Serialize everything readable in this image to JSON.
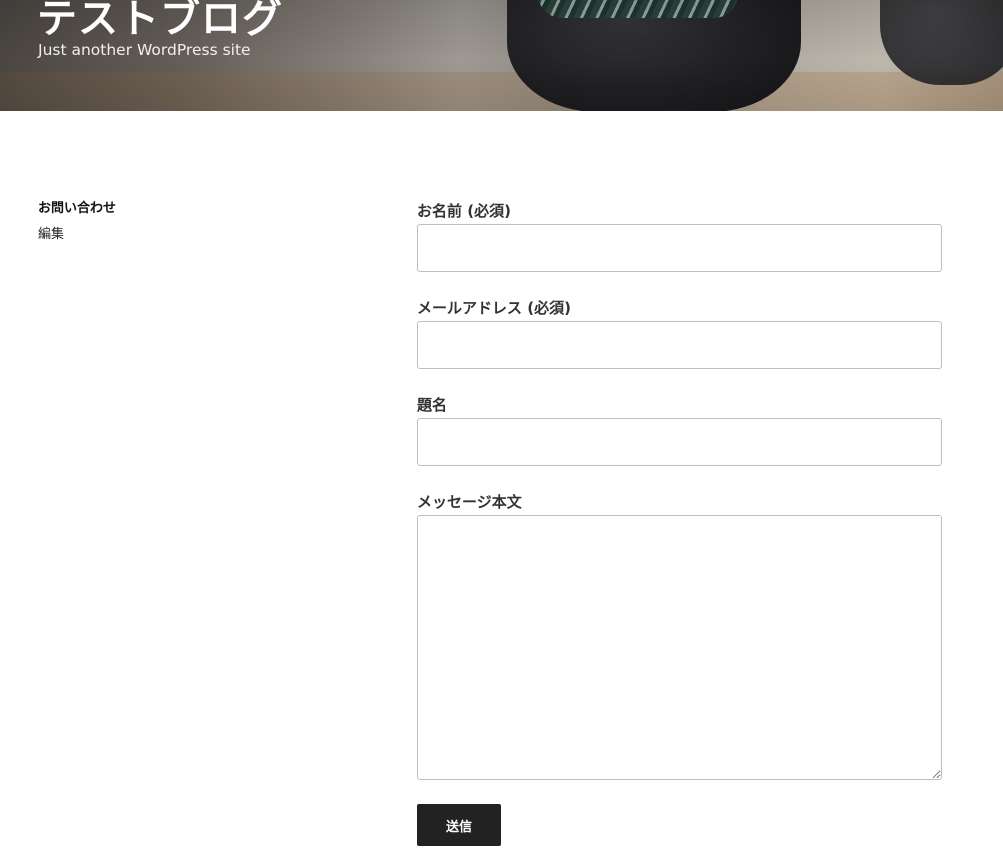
{
  "header": {
    "site_title": "テストブログ",
    "site_description": "Just another WordPress site"
  },
  "sidebar": {
    "page_title": "お問い合わせ",
    "edit_link": "編集"
  },
  "form": {
    "name_label": "お名前 (必須)",
    "name_value": "",
    "email_label": "メールアドレス (必須)",
    "email_value": "",
    "subject_label": "題名",
    "subject_value": "",
    "message_label": "メッセージ本文",
    "message_value": "",
    "submit_label": "送信"
  },
  "colors": {
    "button_bg": "#222222",
    "button_text": "#ffffff",
    "input_border": "#bfbfbf"
  }
}
